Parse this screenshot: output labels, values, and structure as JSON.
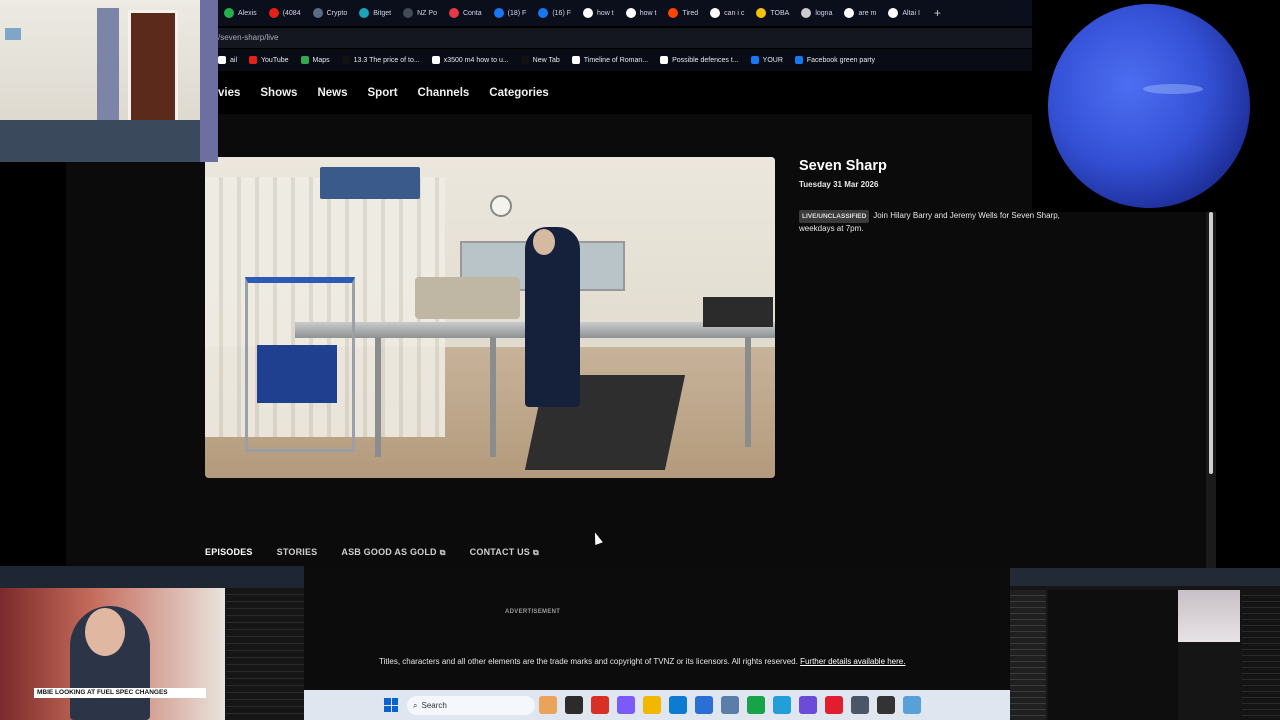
{
  "browser": {
    "tabs": [
      {
        "label": "Alexis",
        "color": "#22b14c"
      },
      {
        "label": "(4084",
        "color": "#e62117"
      },
      {
        "label": "Crypto",
        "color": "#5a6b84"
      },
      {
        "label": "Bitget",
        "color": "#1aa4b8"
      },
      {
        "label": "NZ Po",
        "color": "#444a56"
      },
      {
        "label": "Conta",
        "color": "#e63946"
      },
      {
        "label": "(18) F",
        "color": "#1877f2"
      },
      {
        "label": "(16) F",
        "color": "#1877f2"
      },
      {
        "label": "how t",
        "color": "#ffffff"
      },
      {
        "label": "how t",
        "color": "#ffffff"
      },
      {
        "label": "Tired",
        "color": "#ff4500"
      },
      {
        "label": "can i c",
        "color": "#ffffff"
      },
      {
        "label": "TOBA",
        "color": "#f4c20d"
      },
      {
        "label": "logna",
        "color": "#cccccc"
      },
      {
        "label": "are m",
        "color": "#ffffff"
      },
      {
        "label": "Altai I",
        "color": "#ffffff"
      }
    ],
    "new_tab_symbol": "+",
    "url": "/seven-sharp/live",
    "bookmarks": [
      {
        "label": "ail",
        "color": "#ffffff"
      },
      {
        "label": "YouTube",
        "color": "#e62117"
      },
      {
        "label": "Maps",
        "color": "#34a853"
      },
      {
        "label": "13.3 The price of to...",
        "color": "#111111"
      },
      {
        "label": "x3500 m4 how to u...",
        "color": "#ffffff"
      },
      {
        "label": "New Tab",
        "color": "#111111"
      },
      {
        "label": "Timeline of Roman...",
        "color": "#ffffff"
      },
      {
        "label": "Possible defences t...",
        "color": "#ffffff"
      },
      {
        "label": "YOUR",
        "color": "#1877f2"
      },
      {
        "label": "Facebook green party",
        "color": "#1877f2"
      }
    ]
  },
  "site_nav": [
    "vies",
    "Shows",
    "News",
    "Sport",
    "Channels",
    "Categories"
  ],
  "show": {
    "title": "Seven Sharp",
    "date": "Tuesday 31 Mar 2026",
    "badge": "LIVE/UNCLASSIFIED",
    "description": "Join Hilary Barry and Jeremy Wells for Seven Sharp, weekdays at 7pm."
  },
  "section_tabs": {
    "episodes": "EPISODES",
    "stories": "STORIES",
    "asb": "ASB GOOD AS GOLD",
    "contact": "CONTACT US",
    "external_symbol": "⧉"
  },
  "footer": {
    "ad_label": "ADVERTISEMENT",
    "legal_text": "Titles, characters and all other elements are the trade marks and copyright of TVNZ or its licensors. All rights reserved.",
    "legal_link": "Further details available here."
  },
  "taskbar": {
    "search_placeholder": "Search",
    "icons": [
      "#e9a35a",
      "#2b2b2b",
      "#d93025",
      "#7a5af8",
      "#f2b800",
      "#0c7bd1",
      "#2a6fd6",
      "#5a7ea8",
      "#16a34a",
      "#229ed9",
      "#6b4bd8",
      "#e11d2f",
      "#4a5568",
      "#333333",
      "#5aa0d8"
    ]
  },
  "overlay_news": {
    "chyron": "MBIE LOOKING AT FUEL SPEC CHANGES"
  }
}
